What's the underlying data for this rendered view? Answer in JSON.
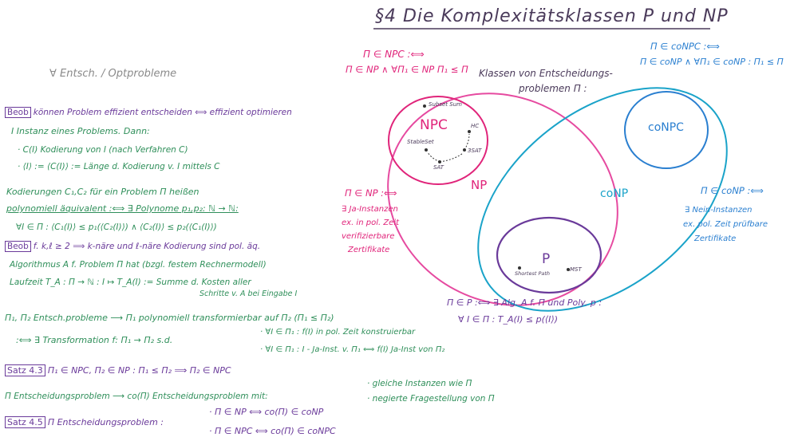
{
  "colors": {
    "green": "#2f8f5a",
    "purple": "#6a3a9a",
    "magenta": "#e0247a",
    "blue": "#2a7fd0",
    "cyan": "#1aa3c9",
    "grey": "#8a8a8a"
  },
  "header": {
    "title": "§4 Die Komplexitätsklassen P und NP",
    "subtitle": "∀ Entsch. / Optprobleme"
  },
  "left": {
    "beob1_tag": "Beob",
    "beob1": "können Problem effizient entscheiden ⟺ effizient optimieren",
    "instanz": "I Instanz eines Problems. Dann:",
    "bullet1": "· C(I)  Kodierung von I (nach Verfahren C)",
    "bullet2": "· ⟨I⟩ := ⟨C(I)⟩ := Länge d. Kodierung v. I mittels C",
    "kod1": "Kodierungen C₁,C₂ für ein Problem Π heißen",
    "kod2": "polynomiell äquivalent :⟺ ∃ Polynome p₁,p₂: ℕ → ℕ:",
    "kod3": "∀I ∈ Π : ⟨C₁(I)⟩ ≤ p₁(⟨C₂(I)⟩) ∧ ⟨C₂(I)⟩ ≤ p₂(⟨C₁(I)⟩)",
    "beob2_tag": "Beob",
    "beob2": "f. k,ℓ ≥ 2 ⟹ k-näre und ℓ-näre Kodierung sind pol. äq.",
    "algo1": "Algorithmus A f. Problem Π hat (bzgl. festem Rechnermodell)",
    "algo2": "Laufzeit  T_A : Π → ℕ : I ↦ T_A(I) := Summe d. Kosten aller",
    "algo3": "Schritte v. A bei Eingabe I",
    "trans1": "Π₁, Π₂  Entsch.probleme ⟶ Π₁ polynomiell transformierbar auf Π₂ (Π₁ ≤ Π₂)",
    "trans2": ":⟺ ∃ Transformation  f: Π₁ → Π₂  s.d.",
    "trans3": "· ∀I ∈ Π₁ : f(I) in pol. Zeit konstruierbar",
    "trans4": "· ∀I ∈ Π₁ : I - Ja-Inst. v. Π₁ ⟺ f(I) Ja-Inst von Π₂",
    "satz43_tag": "Satz 4.3",
    "satz43": "Π₁ ∈ NPC, Π₂ ∈ NP : Π₁ ≤ Π₂ ⟹ Π₂ ∈ NPC",
    "co1": "Π  Entscheidungsproblem ⟶ co(Π) Entscheidungsproblem mit:",
    "co2": "· gleiche Instanzen wie Π",
    "co3": "· negierte Fragestellung von Π",
    "satz45_tag": "Satz 4.5",
    "satz45": "Π  Entscheidungsproblem :",
    "satz45a": "· Π ∈ NP  ⟺  co(Π) ∈ coNP",
    "satz45b": "· Π ∈ NPC ⟺ co(Π) ∈ coNPC"
  },
  "diagram": {
    "npc_def1": "Π ∈ NPC :⟺",
    "npc_def2": "Π ∈ NP ∧ ∀Π₁ ∈ NP Π₁ ≤ Π",
    "classes1": "Klassen von Entscheidungs-",
    "classes2": "problemen Π :",
    "conpc_def1": "Π ∈ coNPC :⟺",
    "conpc_def2": "Π ∈ coNP ∧ ∀Π₁ ∈ coNP : Π₁ ≤ Π",
    "label_npc": "NPC",
    "label_np": "NP",
    "label_conp": "coNP",
    "label_conpc": "coNPC",
    "label_p": "P",
    "subsetsum": "Subset Sum",
    "hc": "HC",
    "stableset": "StableSet",
    "threesat": "3SAT",
    "sat": "SAT",
    "shortest_path": "Shortest Path",
    "mst": "MST",
    "np_def1": "Π ∈ NP :⟺",
    "np_def2": "∃ Ja-Instanzen",
    "np_def3": "ex. in pol. Zeit",
    "np_def4": "verifizierbare",
    "np_def5": "Zertifikate",
    "conp_def1": "Π ∈ coNP :⟺",
    "conp_def2": "∃ Nein-Instanzen",
    "conp_def3": "ex. pol. Zeit prüfbare",
    "conp_def4": "Zertifikate",
    "p_def1": "Π ∈ P :⟺ ∃ Alg. A f. Π und Poly. p :",
    "p_def2": "∀ I ∈ Π : T_A(I) ≤ p(⟨I⟩)"
  }
}
